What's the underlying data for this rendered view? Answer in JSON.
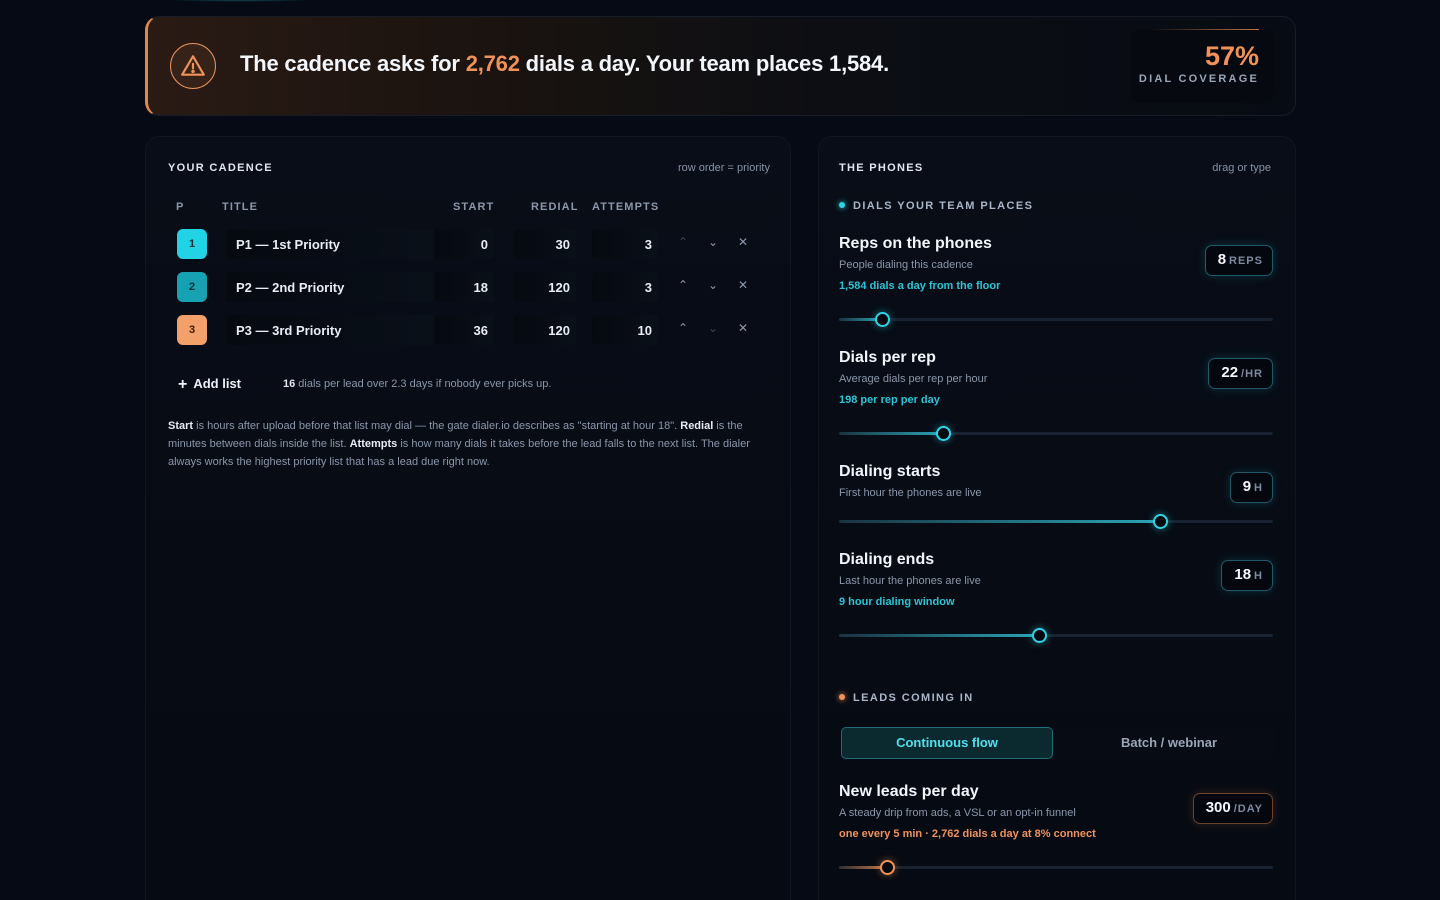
{
  "banner": {
    "pre": "The cadence asks for ",
    "required_dials": "2,762",
    "mid": " dials a day. Your team places ",
    "placed_dials": "1,584.",
    "coverage_value": "57%",
    "coverage_label": "DIAL COVERAGE",
    "icon": "warning-icon"
  },
  "cadence": {
    "title": "YOUR CADENCE",
    "hint": "row order = priority",
    "columns": {
      "p": "P",
      "title": "TITLE",
      "start": "START",
      "redial": "REDIAL",
      "attempts": "ATTEMPTS"
    },
    "rows": [
      {
        "p": "1",
        "title": "P1 — 1st Priority",
        "start": "0",
        "redial": "30",
        "attempts": "3",
        "color": "#22d3e6"
      },
      {
        "p": "2",
        "title": "P2 — 2nd Priority",
        "start": "18",
        "redial": "120",
        "attempts": "3",
        "color": "#1ba6b8"
      },
      {
        "p": "3",
        "title": "P3 — 3rd Priority",
        "start": "36",
        "redial": "120",
        "attempts": "10",
        "color": "#f4a06a"
      }
    ],
    "add_list": "Add list",
    "dials_count": "16",
    "dials_note": " dials per lead over 2.3 days if nobody ever picks up.",
    "explain": {
      "start_term": "Start",
      "start_text": " is hours after upload before that list may dial — the gate dialer.io describes as \"starting at hour 18\". ",
      "redial_term": "Redial",
      "redial_text": " is the minutes between dials inside the list. ",
      "attempts_term": "Attempts",
      "attempts_text": " is how many dials it takes before the lead falls to the next list. The dialer always works the highest priority list that has a lead due right now."
    }
  },
  "phones": {
    "title": "THE PHONES",
    "hint": "drag or type",
    "section_dials": "DIALS YOUR TEAM PLACES",
    "section_leads": "LEADS COMING IN",
    "reps": {
      "title": "Reps on the phones",
      "sub": "People dialing this cadence",
      "note": "1,584 dials a day from the floor",
      "value": "8",
      "unit": "REPS",
      "level": 0.1
    },
    "dials_per_rep": {
      "title": "Dials per rep",
      "sub": "Average dials per rep per hour",
      "note": "198 per rep per day",
      "value": "22",
      "unit": "/HR",
      "level": 0.24
    },
    "start": {
      "title": "Dialing starts",
      "sub": "First hour the phones are live",
      "value": "9",
      "unit": "H",
      "level": 0.74
    },
    "end": {
      "title": "Dialing ends",
      "sub": "Last hour the phones are live",
      "note": "9 hour dialing window",
      "value": "18",
      "unit": "H",
      "level": 0.46
    },
    "modes": {
      "active": "Continuous flow",
      "inactive": "Batch / webinar"
    },
    "leads": {
      "title": "New leads per day",
      "sub": "A steady drip from ads, a VSL or an opt-in funnel",
      "note": "one every 5 min · 2,762 dials a day at 8% connect",
      "value": "300",
      "unit": "/DAY",
      "level": 0.11
    }
  },
  "colors": {
    "accent_cyan": "#2dd4e6",
    "accent_orange": "#f0925a",
    "background": "#050a14"
  }
}
